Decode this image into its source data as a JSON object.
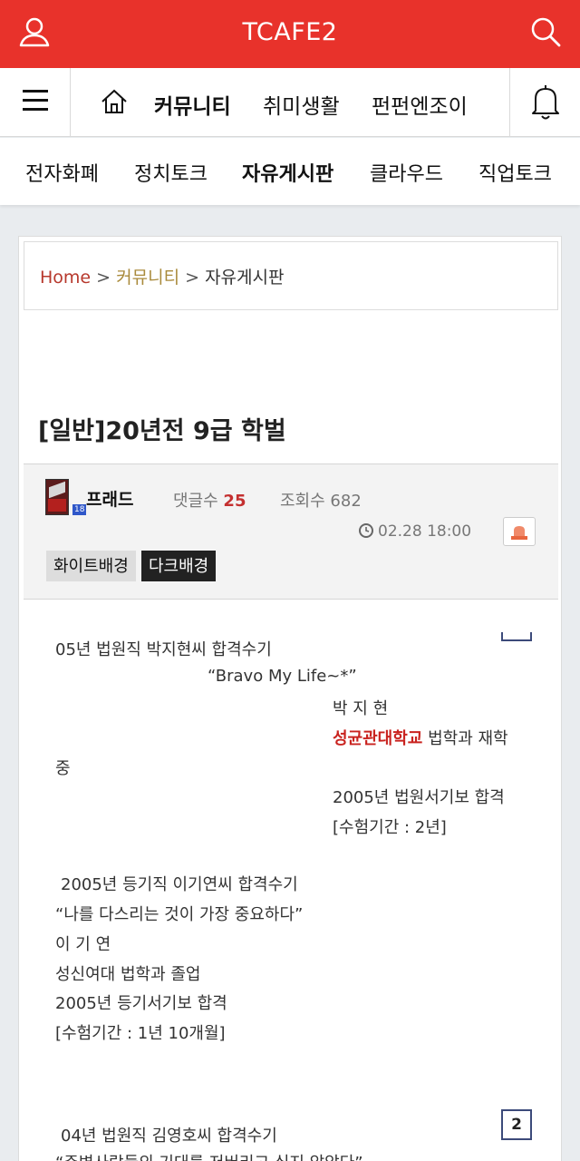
{
  "header": {
    "title": "TCAFE2",
    "user_icon": "user-icon",
    "search_icon": "search-icon"
  },
  "nav_primary": {
    "menu_icon": "hamburger-menu-icon",
    "home_icon": "home-icon",
    "items": [
      "커뮤니티",
      "취미생활",
      "펀펀엔조이"
    ],
    "active": "커뮤니티",
    "bell_icon": "bell-icon"
  },
  "nav_secondary": {
    "items": [
      "전자화폐",
      "정치토크",
      "자유게시판",
      "클라우드",
      "직업토크"
    ],
    "active": "자유게시판"
  },
  "breadcrumb": {
    "home": "Home",
    "sep": ">",
    "community": "커뮤니티",
    "board": "자유게시판"
  },
  "post": {
    "title": "[일반]20년전 9급 학벌",
    "author": "프래드",
    "level_badge": "18",
    "comments_label": "댓글수",
    "comments_count": "25",
    "views_label": "조회수",
    "views_count": "682",
    "date": "02.28 18:00",
    "btn_white": "화이트배경",
    "btn_dark": "다크배경"
  },
  "content": {
    "l1": "05년 법원직 박지현씨 합격수기",
    "l2": "“Bravo My Life~*”",
    "l3": "박 지 현",
    "l4_red": "성균관대학교",
    "l4_rest": "법학과 재학",
    "l5": "중",
    "l6": "2005년 법원서기보 합격",
    "l7": "[수험기간 : 2년]",
    "l8": "2005년 등기직 이기연씨 합격수기",
    "l9": "“나를 다스리는 것이 가장 중요하다”",
    "l10": "이 기 연",
    "l11": "성신여대 법학과 졸업",
    "l12": "2005년 등기서기보 합격",
    "l13": "[수험기간 : 1년 10개월]",
    "l14": "04년 법원직 김영호씨 합격수기",
    "l15": "“주변사람들의 기대를 저버리고 싶지 않았다”",
    "page_box": "2"
  },
  "colors": {
    "brand_red": "#e8322b",
    "comment_count": "#c43030",
    "highlight_red": "#c9231f"
  }
}
